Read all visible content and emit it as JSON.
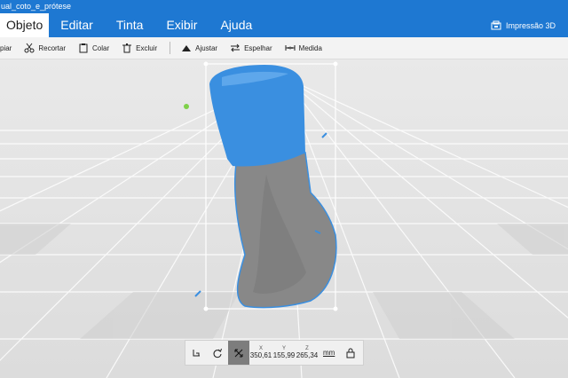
{
  "window": {
    "title": "ual_coto_e_prótese"
  },
  "menu": {
    "items": [
      {
        "label": "Objeto"
      },
      {
        "label": "Editar"
      },
      {
        "label": "Tinta"
      },
      {
        "label": "Exibir"
      },
      {
        "label": "Ajuda"
      }
    ],
    "print3d_label": "Impressão 3D"
  },
  "toolbar": {
    "copy_label": "piar",
    "cut_label": "Recortar",
    "paste_label": "Colar",
    "delete_label": "Excluir",
    "fit_label": "Ajustar",
    "mirror_label": "Espelhar",
    "measure_label": "Medida"
  },
  "transform": {
    "x_label": "X",
    "x_value": "350,61",
    "y_label": "Y",
    "y_value": "155,99",
    "z_label": "Z",
    "z_value": "265,34",
    "unit": "mm"
  },
  "colors": {
    "accent": "#1e78d2",
    "socket": "#3a8fe0",
    "stump": "#8a8a8a"
  }
}
